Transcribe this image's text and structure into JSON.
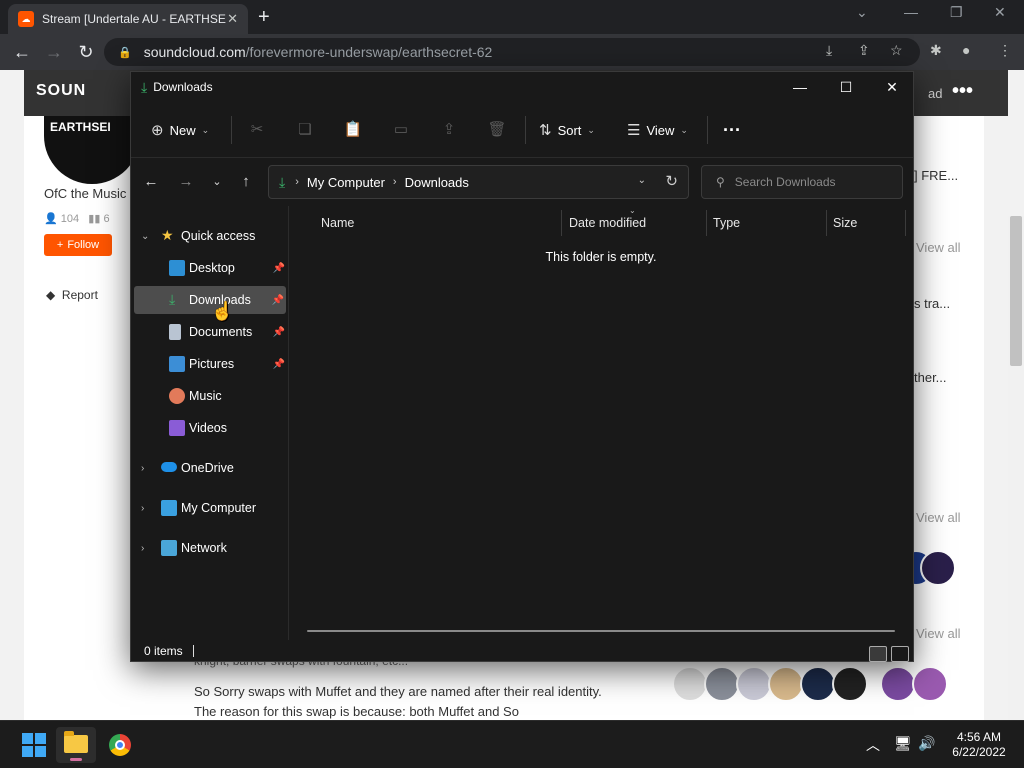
{
  "browser": {
    "tab_title": "Stream [Undertale AU - EARTHSE",
    "url_host": "soundcloud.com",
    "url_path": "/forevermore-underswap/earthsecret-62"
  },
  "soundcloud": {
    "logo": "SOUN",
    "upload_label": "ad",
    "avatar_text": "EARTHSEI",
    "artist_name": "OfC the Music",
    "followers": "104",
    "tracks": "6",
    "follow_label": "Follow",
    "report_label": "Report",
    "side_texts": [
      "] FRE...",
      "View all",
      "s tra...",
      "ther...",
      "View all",
      "View all"
    ],
    "desc_tail": "knight, barrier swaps with fountain, etc...",
    "description": "So Sorry swaps with Muffet and they are named after their real identity. The reason for this swap is because: both Muffet and So"
  },
  "explorer": {
    "title": "Downloads",
    "commands": {
      "new": "New",
      "sort": "Sort",
      "view": "View"
    },
    "breadcrumb": [
      "My Computer",
      "Downloads"
    ],
    "search_placeholder": "Search Downloads",
    "nav_tree": {
      "quick_access": "Quick access",
      "desktop": "Desktop",
      "downloads": "Downloads",
      "documents": "Documents",
      "pictures": "Pictures",
      "music": "Music",
      "videos": "Videos",
      "onedrive": "OneDrive",
      "my_computer": "My Computer",
      "network": "Network"
    },
    "columns": {
      "name": "Name",
      "date_modified": "Date modified",
      "type": "Type",
      "size": "Size"
    },
    "empty_message": "This folder is empty.",
    "status": "0 items"
  },
  "taskbar": {
    "time": "4:56 AM",
    "date": "6/22/2022"
  },
  "colors": {
    "soundcloud_orange": "#ff5500",
    "download_green": "#3bb36b",
    "explorer_bg": "#191919"
  }
}
